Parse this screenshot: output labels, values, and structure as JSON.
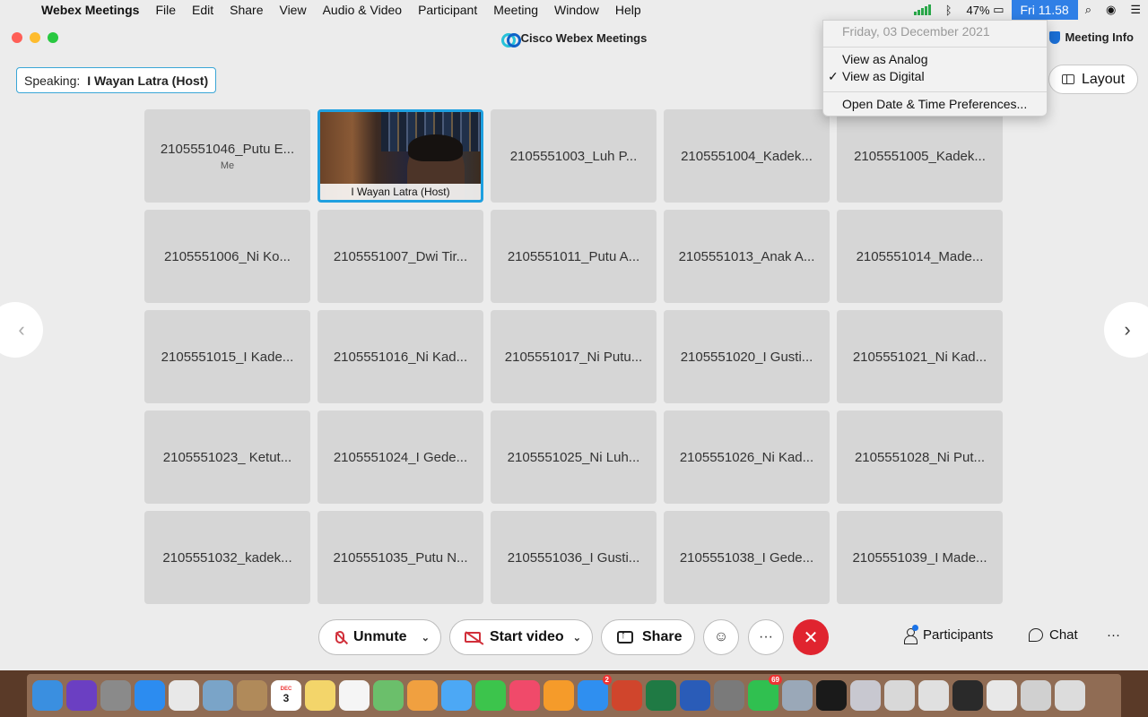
{
  "menubar": {
    "app_name": "Webex Meetings",
    "items": [
      "File",
      "Edit",
      "Share",
      "View",
      "Audio & Video",
      "Participant",
      "Meeting",
      "Window",
      "Help"
    ],
    "battery": "47%",
    "clock": "Fri 11.58"
  },
  "clock_menu": {
    "date": "Friday, 03 December 2021",
    "analog": "View as Analog",
    "digital": "View as Digital",
    "check": "✓",
    "prefs": "Open Date & Time Preferences..."
  },
  "window": {
    "title": "Cisco Webex Meetings",
    "meeting_info": "Meeting Info",
    "speaking_label": "Speaking:",
    "speaking_name": "I Wayan Latra (Host)",
    "layout": "Layout"
  },
  "tiles": [
    {
      "name": "2105551046_Putu E...",
      "sub": "Me"
    },
    {
      "name": "I Wayan Latra  (Host)",
      "video": true
    },
    {
      "name": "2105551003_Luh P..."
    },
    {
      "name": "2105551004_Kadek..."
    },
    {
      "name": "2105551005_Kadek..."
    },
    {
      "name": "2105551006_Ni Ko..."
    },
    {
      "name": "2105551007_Dwi Tir..."
    },
    {
      "name": "2105551011_Putu A..."
    },
    {
      "name": "2105551013_Anak A..."
    },
    {
      "name": "2105551014_Made..."
    },
    {
      "name": "2105551015_I Kade..."
    },
    {
      "name": "2105551016_Ni Kad..."
    },
    {
      "name": "2105551017_Ni Putu..."
    },
    {
      "name": "2105551020_I Gusti..."
    },
    {
      "name": "2105551021_Ni Kad..."
    },
    {
      "name": "2105551023_ Ketut..."
    },
    {
      "name": "2105551024_I Gede..."
    },
    {
      "name": "2105551025_Ni Luh..."
    },
    {
      "name": "2105551026_Ni Kad..."
    },
    {
      "name": "2105551028_Ni Put..."
    },
    {
      "name": "2105551032_kadek..."
    },
    {
      "name": "2105551035_Putu N..."
    },
    {
      "name": "2105551036_I Gusti..."
    },
    {
      "name": "2105551038_I Gede..."
    },
    {
      "name": "2105551039_I Made..."
    }
  ],
  "controls": {
    "unmute": "Unmute",
    "start_video": "Start video",
    "share": "Share",
    "more": "···",
    "end": "✕",
    "participants": "Participants",
    "chat": "Chat",
    "overflow": "···"
  },
  "dock": {
    "apps": [
      {
        "icon": "finder-icon",
        "color": "#3a8fe0"
      },
      {
        "icon": "siri-icon",
        "color": "#6b3fc2"
      },
      {
        "icon": "launchpad-icon",
        "color": "#8a8a8a"
      },
      {
        "icon": "safari-icon",
        "color": "#2c8cf0"
      },
      {
        "icon": "chrome-icon",
        "color": "#e8e8e8"
      },
      {
        "icon": "preview-icon",
        "color": "#7aa4c8"
      },
      {
        "icon": "contacts-icon",
        "color": "#b08a5a"
      },
      {
        "icon": "calendar-icon",
        "color": "#ffffff"
      },
      {
        "icon": "notes-icon",
        "color": "#f3d56a"
      },
      {
        "icon": "reminders-icon",
        "color": "#f5f5f5"
      },
      {
        "icon": "maps-icon",
        "color": "#6bbf6b"
      },
      {
        "icon": "photos-icon",
        "color": "#f0a040"
      },
      {
        "icon": "messages-icon",
        "color": "#4ca8f5"
      },
      {
        "icon": "facetime-icon",
        "color": "#3cc44c"
      },
      {
        "icon": "music-icon",
        "color": "#f04a6a"
      },
      {
        "icon": "books-icon",
        "color": "#f59b2a"
      },
      {
        "icon": "app-store-icon",
        "color": "#2f8ff0",
        "badge": "2"
      },
      {
        "icon": "powerpoint-icon",
        "color": "#d0452c"
      },
      {
        "icon": "excel-icon",
        "color": "#1f7a44"
      },
      {
        "icon": "word-icon",
        "color": "#2a5cb8"
      },
      {
        "icon": "system-preferences-icon",
        "color": "#7a7a7a"
      },
      {
        "icon": "whatsapp-icon",
        "color": "#30c050",
        "badge": "69"
      },
      {
        "icon": "screenshot-icon",
        "color": "#9aa8b8"
      },
      {
        "icon": "webex-icon",
        "color": "#1a1a1a"
      },
      {
        "icon": "utilities-icon",
        "color": "#c8c8d0"
      },
      {
        "icon": "document-icon",
        "color": "#d8d8d8"
      },
      {
        "icon": "window-thumbnail-icon",
        "color": "#e0e0e0"
      },
      {
        "icon": "window-thumbnail-icon",
        "color": "#2a2a2a"
      },
      {
        "icon": "window-thumbnail-icon",
        "color": "#e8e8e8"
      },
      {
        "icon": "window-thumbnail-icon",
        "color": "#d0d0d0"
      },
      {
        "icon": "trash-icon",
        "color": "#dcdcdc"
      }
    ],
    "calendar_month": "DEC",
    "calendar_day": "3"
  }
}
